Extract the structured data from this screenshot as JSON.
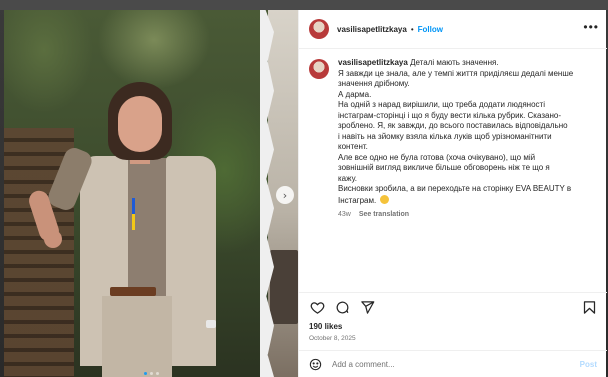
{
  "header": {
    "username": "vasilisapetlitzkaya",
    "separator": "•",
    "follow_label": "Follow",
    "more_label": "•••"
  },
  "caption": {
    "username": "vasilisapetlitzkaya",
    "lines": [
      "Деталі мають значення.",
      "Я завжди це знала, але у темпі життя приділяєш дедалі менше",
      "значення дрібному.",
      "А дарма.",
      "На одній з нарад вирішили, що треба додати людяності",
      "інстаграм-сторінці і що я буду вести кілька рубрик. Сказано-",
      "зроблено. Я, як завжди, до всього поставилась відповідально",
      "і навіть на зйомку взяла кілька луків щоб урізноманітнити",
      "контент.",
      "Але все одно не була готова (хоча очікувано), що мій",
      "зовнішній вигляд викличе більше обговорень ніж те що я",
      "кажу.",
      "Висновки зробила, а ви переходьте на сторінку EVA BEAUTY в",
      "Інстаграм."
    ],
    "age": "43w",
    "translation_label": "See translation"
  },
  "media": {
    "next_icon": "chevron-right-icon",
    "slide_count": 3,
    "active_slide": 0
  },
  "actions": {
    "icons": [
      "heart-icon",
      "comment-icon",
      "share-icon",
      "bookmark-icon"
    ]
  },
  "likes": "190 likes",
  "post_date": "October 8, 2025",
  "comment": {
    "placeholder": "Add a comment...",
    "value": "",
    "post_label": "Post"
  },
  "colors": {
    "link_blue": "#0095f6",
    "post_disabled": "#b3dbff",
    "muted_text": "#737373"
  }
}
